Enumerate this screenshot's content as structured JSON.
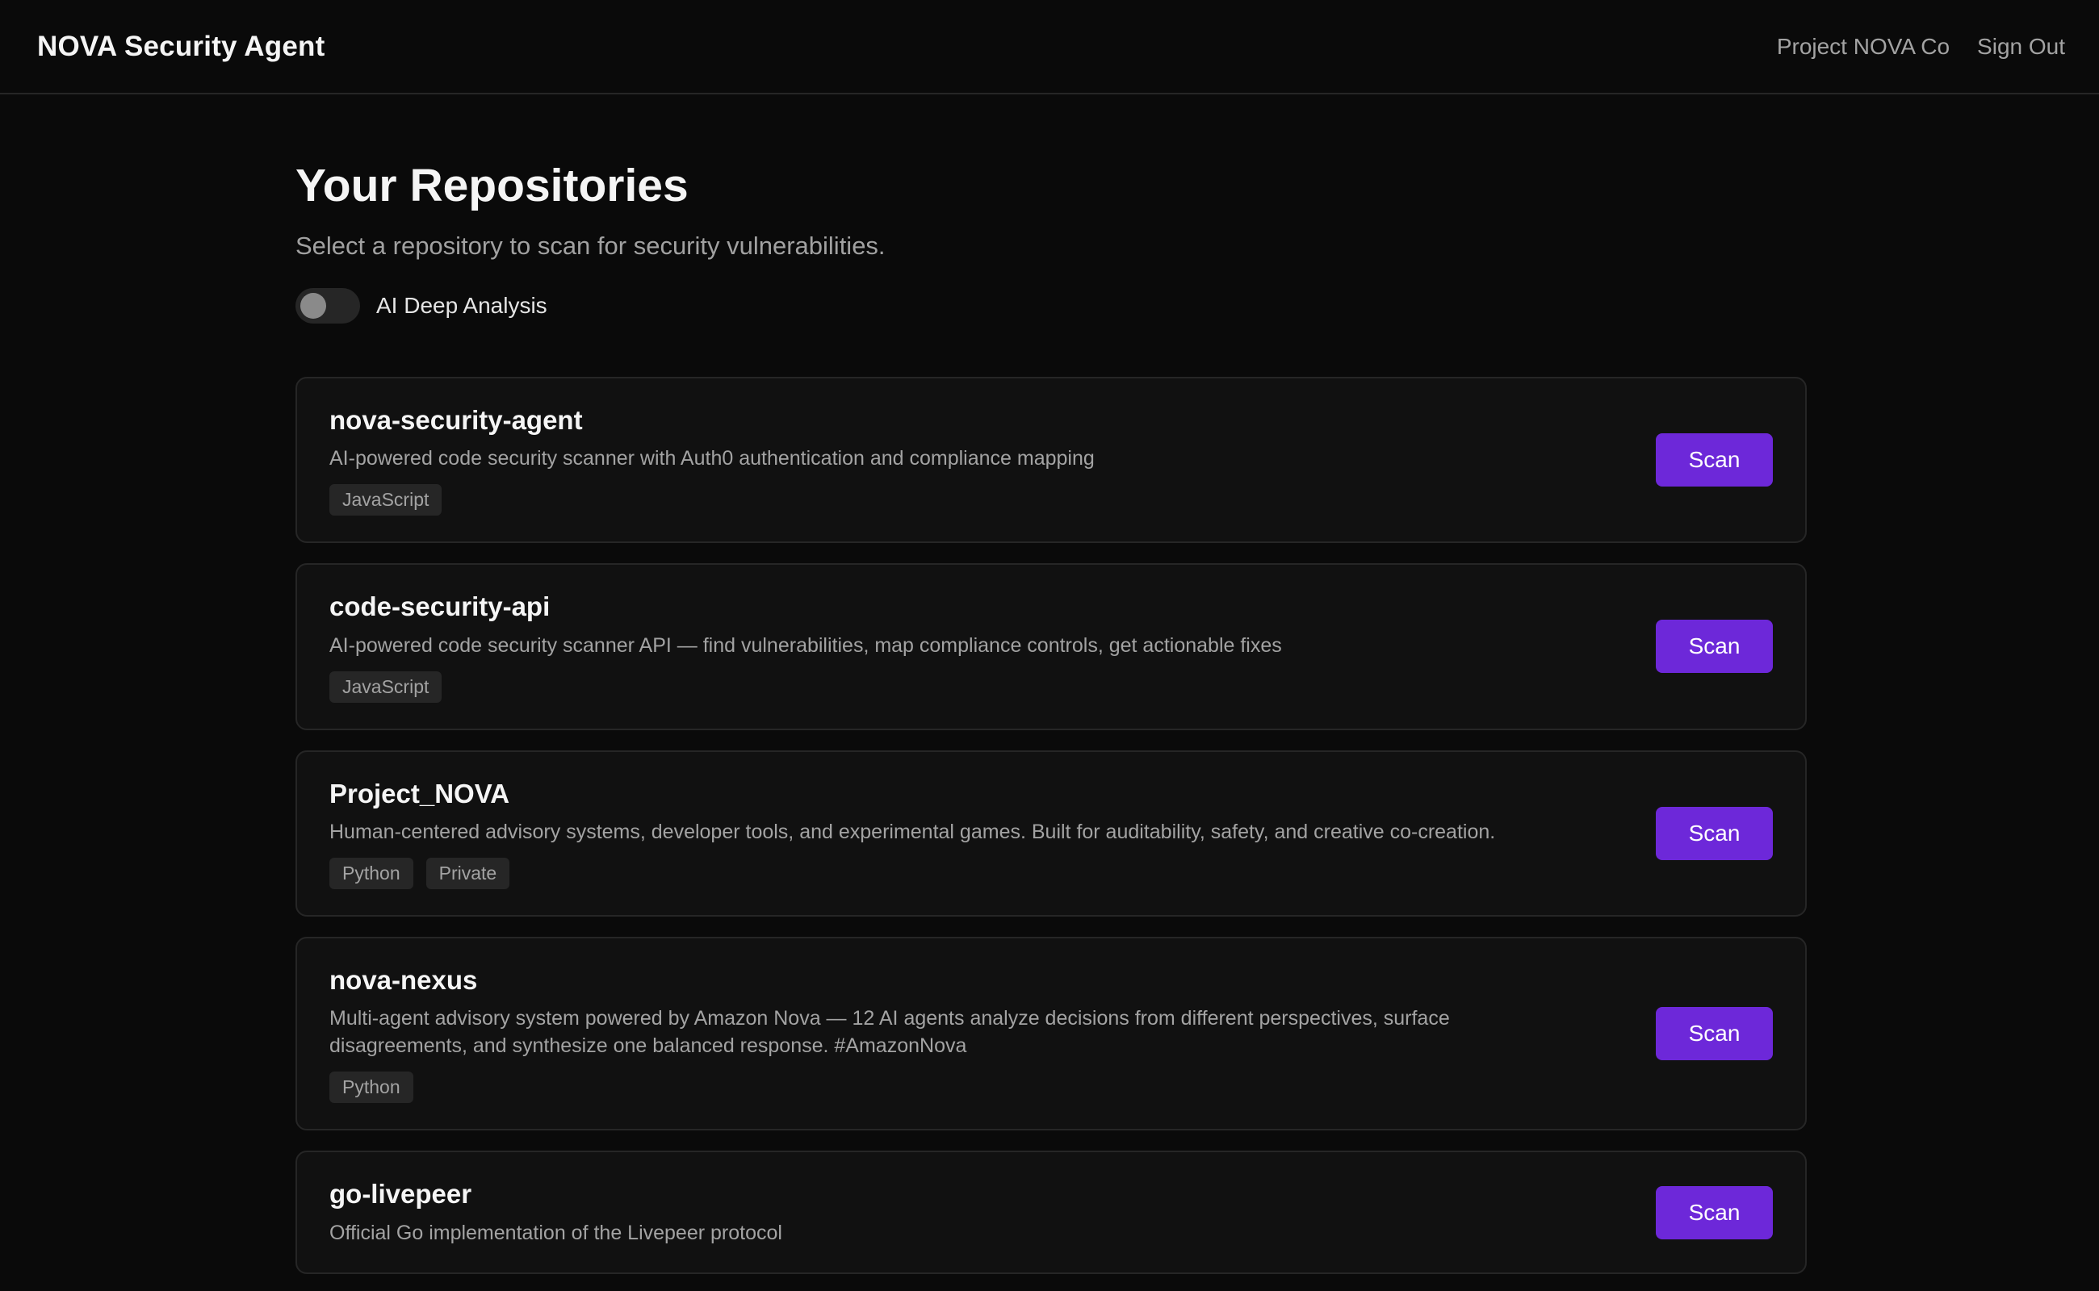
{
  "header": {
    "brand": "NOVA Security Agent",
    "org_link": "Project NOVA Co",
    "signout_link": "Sign Out"
  },
  "main": {
    "title": "Your Repositories",
    "subtitle": "Select a repository to scan for security vulnerabilities.",
    "toggle": {
      "label": "AI Deep Analysis",
      "enabled": false
    }
  },
  "repos": [
    {
      "name": "nova-security-agent",
      "description": "AI-powered code security scanner with Auth0 authentication and compliance mapping",
      "tags": [
        "JavaScript"
      ],
      "button": "Scan"
    },
    {
      "name": "code-security-api",
      "description": "AI-powered code security scanner API — find vulnerabilities, map compliance controls, get actionable fixes",
      "tags": [
        "JavaScript"
      ],
      "button": "Scan"
    },
    {
      "name": "Project_NOVA",
      "description": "Human-centered advisory systems, developer tools, and experimental games. Built for auditability, safety, and creative co-creation.",
      "tags": [
        "Python",
        "Private"
      ],
      "button": "Scan"
    },
    {
      "name": "nova-nexus",
      "description": "Multi-agent advisory system powered by Amazon Nova — 12 AI agents analyze decisions from different perspectives, surface disagreements, and synthesize one balanced response. #AmazonNova",
      "tags": [
        "Python"
      ],
      "button": "Scan"
    },
    {
      "name": "go-livepeer",
      "description": "Official Go implementation of the Livepeer protocol",
      "tags": [],
      "button": "Scan"
    }
  ],
  "colors": {
    "background": "#0a0a0a",
    "card": "#111111",
    "accent": "#6d28d9"
  }
}
